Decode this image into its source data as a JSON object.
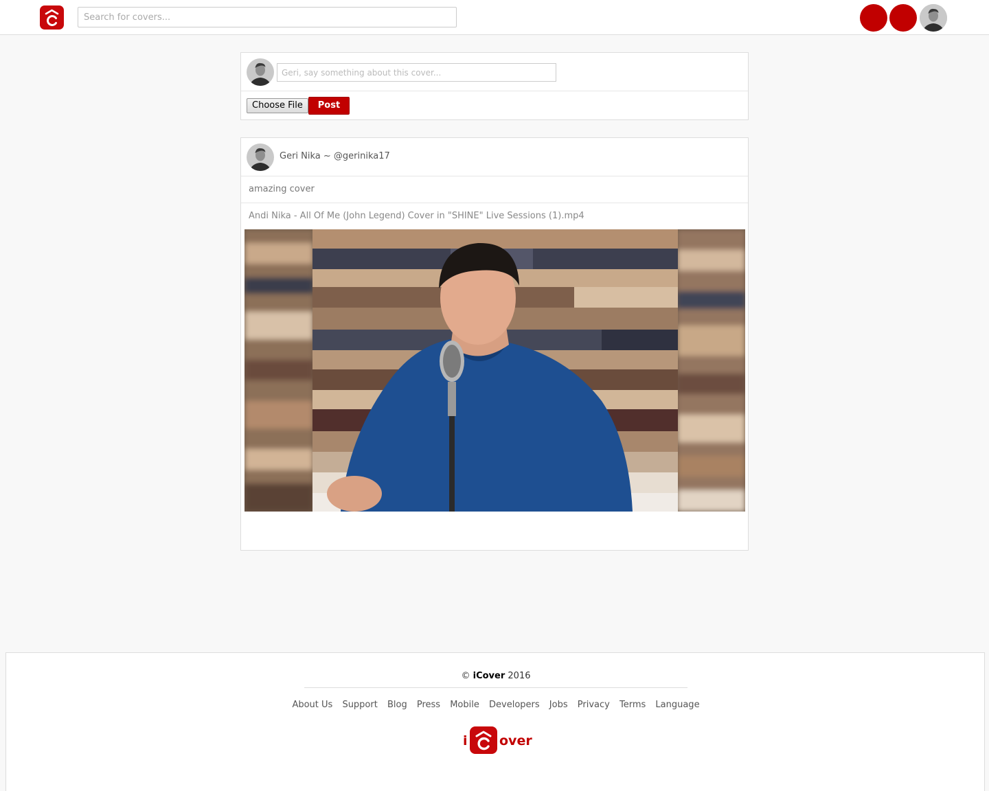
{
  "header": {
    "search_placeholder": "Search for covers...",
    "logo_icon": "icover-logo-icon"
  },
  "colors": {
    "accent": "#c10000",
    "page_bg": "#f8f8f8"
  },
  "composer": {
    "placeholder": "Geri, say something about this cover...",
    "choose_file_label": "Choose File",
    "post_label": "Post"
  },
  "post": {
    "author": "Geri Nika ~ @gerinika17",
    "caption": "amazing cover",
    "filename": "Andi Nika - All Of Me (John Legend) Cover in \"SHINE\" Live Sessions (1).mp4"
  },
  "footer": {
    "copyright_symbol": "©",
    "brand": "iCover",
    "year": "2016",
    "links": [
      "About Us",
      "Support",
      "Blog",
      "Press",
      "Mobile",
      "Developers",
      "Jobs",
      "Privacy",
      "Terms",
      "Language"
    ],
    "logo_left": "i",
    "logo_right": "over"
  }
}
